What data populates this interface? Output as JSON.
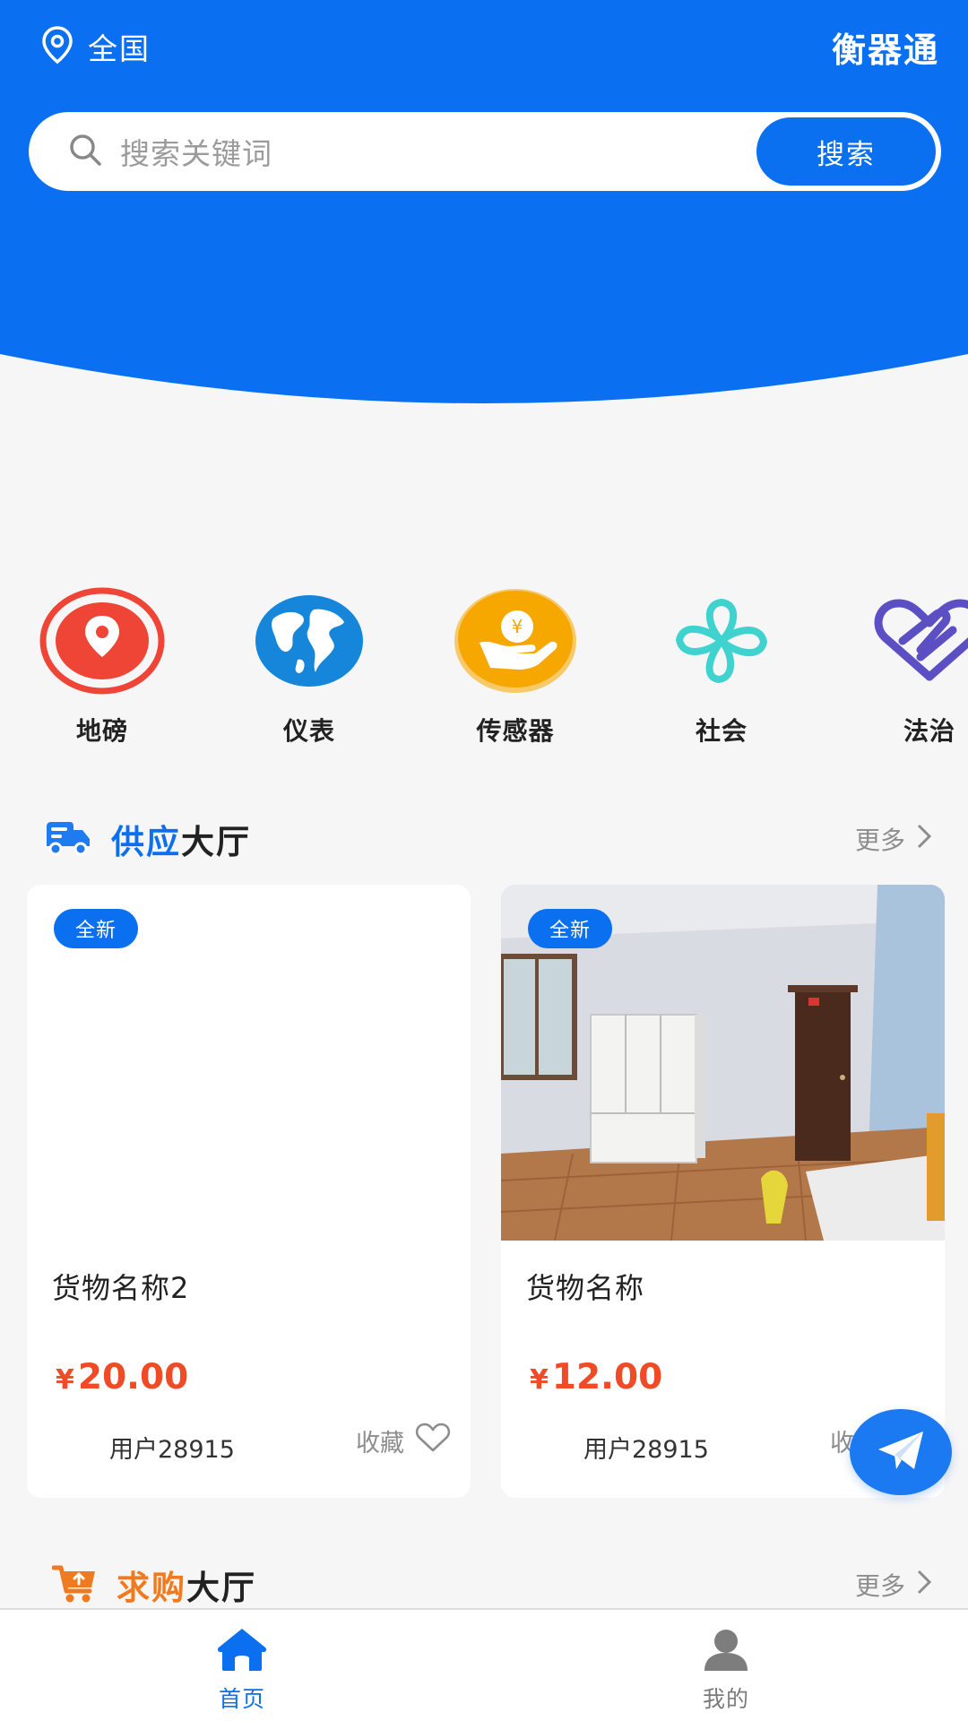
{
  "header": {
    "location": "全国",
    "brand": "衡器通"
  },
  "search": {
    "placeholder": "搜索关键词",
    "button": "搜索"
  },
  "categories": [
    {
      "label": "地磅",
      "icon": "location-pin-icon"
    },
    {
      "label": "仪表",
      "icon": "globe-icon"
    },
    {
      "label": "传感器",
      "icon": "money-hand-icon"
    },
    {
      "label": "社会",
      "icon": "clover-icon"
    },
    {
      "label": "法治",
      "icon": "handshake-heart-icon"
    }
  ],
  "supply": {
    "title_highlight": "供应",
    "title_rest": "大厅",
    "more": "更多"
  },
  "products": [
    {
      "badge": "全新",
      "name": "货物名称2",
      "currency": "¥",
      "price": "20.00",
      "user": "用户28915",
      "fav": "收藏"
    },
    {
      "badge": "全新",
      "name": "货物名称",
      "currency": "¥",
      "price": "12.00",
      "user": "用户28915",
      "fav": "收藏"
    }
  ],
  "demand": {
    "title_highlight": "求购",
    "title_rest": "大厅",
    "more": "更多"
  },
  "tabbar": {
    "home": "首页",
    "mine": "我的"
  },
  "colors": {
    "primary": "#0a70f0",
    "price": "#ee4b26",
    "demand_accent": "#f07a1f"
  }
}
